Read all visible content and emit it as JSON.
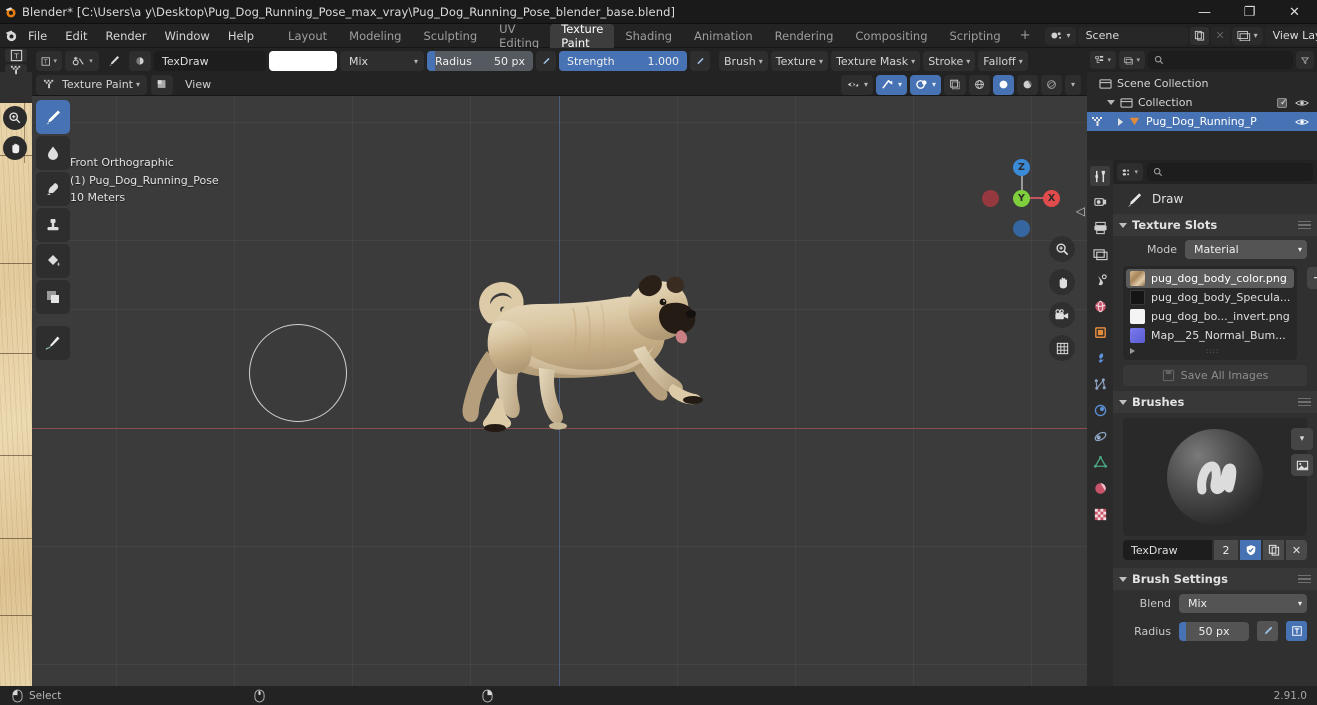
{
  "window": {
    "title": "Blender* [C:\\Users\\a y\\Desktop\\Pug_Dog_Running_Pose_max_vray\\Pug_Dog_Running_Pose_blender_base.blend]",
    "minimize": "—",
    "maximize": "❐",
    "close": "✕"
  },
  "menubar": {
    "items": [
      "File",
      "Edit",
      "Render",
      "Window",
      "Help"
    ]
  },
  "workspace_tabs": [
    {
      "label": "Layout",
      "active": false
    },
    {
      "label": "Modeling",
      "active": false
    },
    {
      "label": "Sculpting",
      "active": false
    },
    {
      "label": "UV Editing",
      "active": false
    },
    {
      "label": "Texture Paint",
      "active": true
    },
    {
      "label": "Shading",
      "active": false
    },
    {
      "label": "Animation",
      "active": false
    },
    {
      "label": "Rendering",
      "active": false
    },
    {
      "label": "Compositing",
      "active": false
    },
    {
      "label": "Scripting",
      "active": false
    }
  ],
  "workspace_add": "+",
  "scene": {
    "name": "Scene",
    "view_layer": "View Layer"
  },
  "tool_header": {
    "brush_name": "TexDraw",
    "color_hex": "#ffffff",
    "blend_mode": "Mix",
    "radius_label": "Radius",
    "radius_value": "50 px",
    "strength_label": "Strength",
    "strength_value": "1.000",
    "menus": [
      "Brush",
      "Texture",
      "Texture Mask",
      "Stroke",
      "Falloff"
    ]
  },
  "viewport_header": {
    "mode": "Texture Paint",
    "menus": [
      "View"
    ]
  },
  "toolbar_tools": [
    {
      "name": "draw-tool",
      "active": true
    },
    {
      "name": "soften-tool",
      "active": false
    },
    {
      "name": "smear-tool",
      "active": false
    },
    {
      "name": "clone-tool",
      "active": false
    },
    {
      "name": "fill-tool",
      "active": false
    },
    {
      "name": "mask-tool",
      "active": false
    },
    {
      "name": "annotate-tool",
      "active": false
    }
  ],
  "viewport_overlay": {
    "line1": "Front Orthographic",
    "line2": "(1) Pug_Dog_Running_Pose",
    "line3": "10 Meters"
  },
  "gizmo": {
    "x": "X",
    "y": "Y",
    "z": "Z"
  },
  "outliner": {
    "search_placeholder": "",
    "rows": [
      {
        "label": "Scene Collection",
        "indent": 0,
        "selected": false,
        "icon": "collection-icon",
        "checkbox": false,
        "eye": false
      },
      {
        "label": "Collection",
        "indent": 1,
        "selected": false,
        "icon": "collection-icon",
        "checkbox": true,
        "eye": true
      },
      {
        "label": "Pug_Dog_Running_P",
        "indent": 2,
        "selected": true,
        "icon": "mesh-object-icon",
        "checkbox": false,
        "eye": true
      }
    ]
  },
  "properties": {
    "search_placeholder": "",
    "active_tab": "tool",
    "tabs": [
      {
        "name": "tool-properties-tab",
        "color": "#d6d6d6"
      },
      {
        "name": "render-properties-tab",
        "color": "#d6d6d6"
      },
      {
        "name": "output-properties-tab",
        "color": "#d6d6d6"
      },
      {
        "name": "view-layer-properties-tab",
        "color": "#d6d6d6"
      },
      {
        "name": "scene-properties-tab",
        "color": "#d6d6d6"
      },
      {
        "name": "world-properties-tab",
        "color": "#c9546a"
      },
      {
        "name": "object-properties-tab",
        "color": "#e08a3c"
      },
      {
        "name": "modifier-properties-tab",
        "color": "#5b8fd6"
      },
      {
        "name": "particle-properties-tab",
        "color": "#8fa5c4"
      },
      {
        "name": "physics-properties-tab",
        "color": "#5b8fd6"
      },
      {
        "name": "constraint-properties-tab",
        "color": "#8fa5c4"
      },
      {
        "name": "object-data-properties-tab",
        "color": "#4aa882"
      },
      {
        "name": "material-properties-tab",
        "color": "#c9546a"
      },
      {
        "name": "texture-properties-tab",
        "color": "#c9546a"
      }
    ],
    "brush_header": "Draw",
    "texture_slots": {
      "title": "Texture Slots",
      "mode_label": "Mode",
      "mode_value": "Material",
      "add_button": "+",
      "slots": [
        {
          "name": "pug_dog_body_color.png",
          "selected": true,
          "thumb": "#c4a57c"
        },
        {
          "name": "pug_dog_body_Specula...",
          "selected": false,
          "thumb": "#151515"
        },
        {
          "name": "pug_dog_bo..._invert.png",
          "selected": false,
          "thumb": "#f2f2f2"
        },
        {
          "name": "Map__25_Normal_Bum...",
          "selected": false,
          "thumb": "#6b6bd8"
        }
      ]
    },
    "save_all_images": "Save All Images",
    "brushes": {
      "title": "Brushes",
      "brush_name": "TexDraw",
      "users_count": "2",
      "fake_user_icon": "shield-icon",
      "duplicate_icon": "copy-icon",
      "delete_icon": "x-icon"
    },
    "brush_settings": {
      "title": "Brush Settings",
      "blend_label": "Blend",
      "blend_value": "Mix",
      "radius_label": "Radius",
      "radius_value": "50 px"
    }
  },
  "statusbar": {
    "select_label": "Select",
    "version": "2.91.0"
  },
  "colors": {
    "accent_blue": "#4772b3",
    "viewport_bg": "#3b3b3b",
    "panel_bg": "#303030",
    "header_bg": "#232323",
    "axis_x": "#be5a5f",
    "axis_z": "#5a78be"
  }
}
